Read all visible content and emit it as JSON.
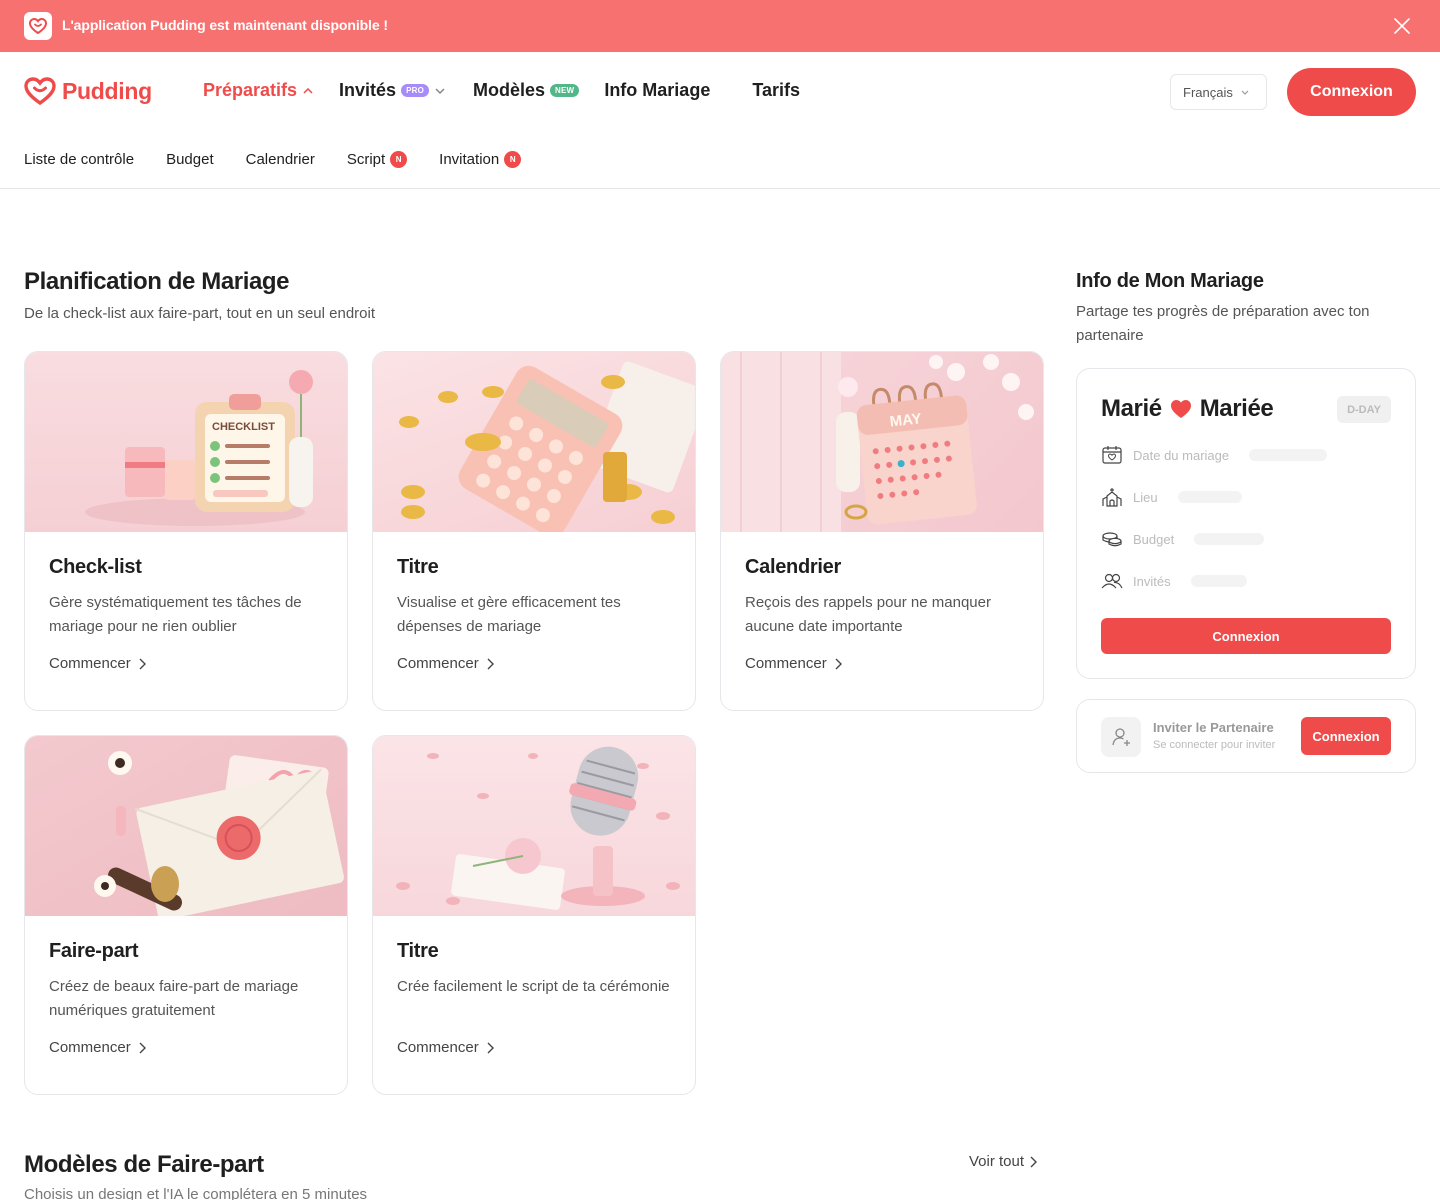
{
  "banner": {
    "text": "L'application Pudding est maintenant disponible !"
  },
  "header": {
    "brand": "Pudding",
    "nav": [
      {
        "label": "Préparatifs",
        "active": true
      },
      {
        "label": "Invités",
        "pill": "PRO"
      },
      {
        "label": "Modèles",
        "pill": "NEW"
      },
      {
        "label": "Info Mariage"
      },
      {
        "label": "Tarifs"
      }
    ],
    "language": "Français",
    "login": "Connexion"
  },
  "subnav": [
    {
      "label": "Liste de contrôle"
    },
    {
      "label": "Budget"
    },
    {
      "label": "Calendrier"
    },
    {
      "label": "Script",
      "badge": "N"
    },
    {
      "label": "Invitation",
      "badge": "N"
    }
  ],
  "planning": {
    "title": "Planification de Mariage",
    "subtitle": "De la check-list aux faire-part, tout en un seul endroit",
    "cards": [
      {
        "title": "Check-list",
        "desc": "Gère systématiquement tes tâches de mariage pour ne rien oublier",
        "cta": "Commencer",
        "image_label": "CHECKLIST"
      },
      {
        "title": "Titre",
        "desc": "Visualise et gère efficacement tes dépenses de mariage",
        "cta": "Commencer"
      },
      {
        "title": "Calendrier",
        "desc": "Reçois des rappels pour ne manquer aucune date importante",
        "cta": "Commencer",
        "image_label": "MAY"
      },
      {
        "title": "Faire-part",
        "desc": "Créez de beaux faire-part de mariage numériques gratuitement",
        "cta": "Commencer"
      },
      {
        "title": "Titre",
        "desc": "Crée facilement le script de ta cérémonie",
        "cta": "Commencer"
      }
    ]
  },
  "side": {
    "title": "Info de Mon Mariage",
    "subtitle": "Partage tes progrès de préparation avec ton partenaire",
    "groom": "Marié",
    "bride": "Mariée",
    "dday": "D-DAY",
    "rows": [
      {
        "label": "Date du mariage",
        "icon": "calendar-heart-icon"
      },
      {
        "label": "Lieu",
        "icon": "chapel-icon"
      },
      {
        "label": "Budget",
        "icon": "coins-icon"
      },
      {
        "label": "Invités",
        "icon": "users-icon"
      }
    ],
    "login": "Connexion",
    "invite_title": "Inviter le Partenaire",
    "invite_sub": "Se connecter pour inviter",
    "invite_button": "Connexion"
  },
  "models": {
    "title": "Modèles de Faire-part",
    "subtitle": "Choisis un design et l'IA le complétera en 5 minutes",
    "see_all": "Voir tout"
  },
  "colors": {
    "brand": "#f04b4b",
    "banner": "#f87171"
  }
}
